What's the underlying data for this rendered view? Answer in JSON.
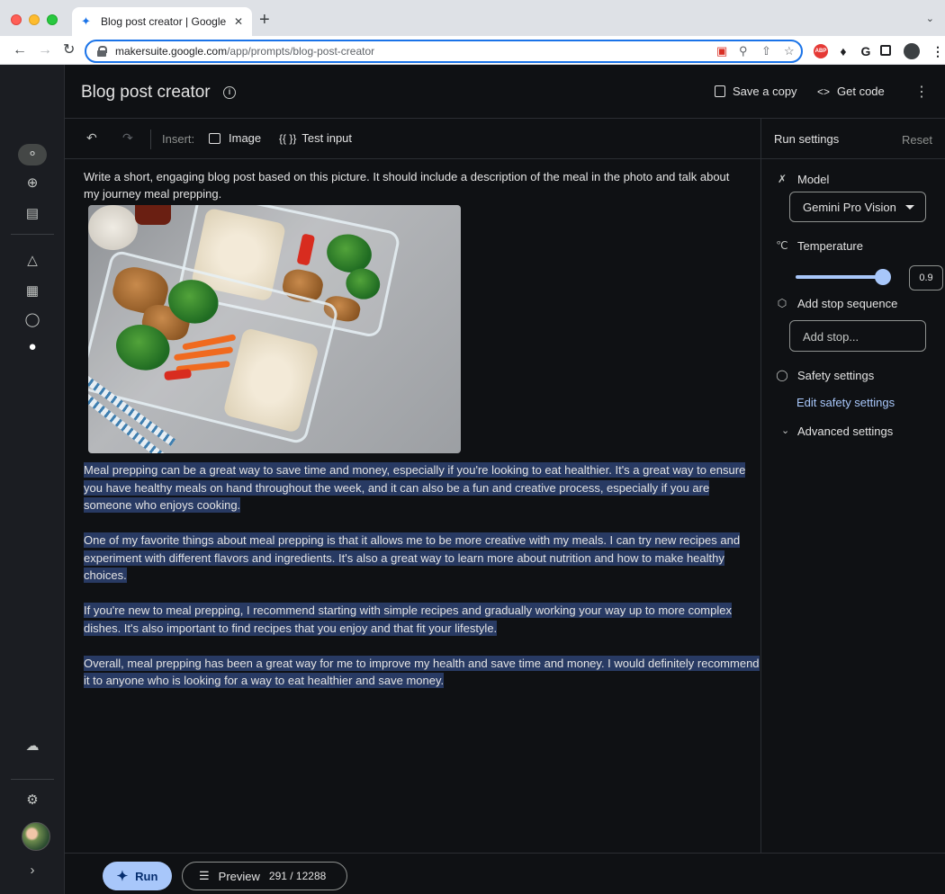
{
  "browser": {
    "tab_title": "Blog post creator | Google AI S",
    "tab_close": "✕",
    "new_tab": "+",
    "tab_menu": "⌄",
    "url_host": "makersuite.google.com",
    "url_path": "/app/prompts/blog-post-creator",
    "icons": [
      "favicon-butterfly-icon",
      "lock-icon",
      "cast-icon",
      "zoom-icon",
      "share-icon",
      "bookmark-star-icon",
      "adblock-icon",
      "extensions-puzzle-icon",
      "google-icon",
      "side-panel-icon",
      "profile-avatar-icon",
      "more-vert-icon"
    ],
    "ext_abp_label": "ABP",
    "ext_g_label": "G"
  },
  "header": {
    "title": "Blog post creator",
    "save_copy_label": "Save a copy",
    "get_code_label": "Get code"
  },
  "editor_toolbar": {
    "insert_label": "Insert:",
    "image_label": "Image",
    "braces": "{{ }}",
    "test_input_label": "Test input"
  },
  "prompt": {
    "text": "Write a short, engaging blog post based on this picture. It should include a description of the meal in the photo and talk about my journey meal prepping."
  },
  "output": {
    "paragraphs": [
      " Meal prepping can be a great way to save time and money, especially if you're looking to eat healthier. It's a great way to ensure you have healthy meals on hand throughout the week, and it can also be a fun and creative process, especially if you are someone who enjoys cooking.",
      "One of my favorite things about meal prepping is that it allows me to be more creative with my meals. I can try new recipes and experiment with different flavors and ingredients. It's also a great way to learn more about nutrition and how to make healthy choices.",
      "If you're new to meal prepping, I recommend starting with simple recipes and gradually working your way up to more complex dishes. It's also important to find recipes that you enjoy and that fit your lifestyle.",
      "Overall, meal prepping has been a great way for me to improve my health and save time and money. I would definitely recommend it to anyone who is looking for a way to eat healthier and save money."
    ]
  },
  "footer": {
    "run_label": "Run",
    "preview_label": "Preview",
    "token_count": "291 / 12288"
  },
  "settings": {
    "title": "Run settings",
    "reset_label": "Reset",
    "model_label": "Model",
    "model_value": "Gemini Pro Vision",
    "temperature_label": "Temperature",
    "temperature_value": "0.9",
    "temperature_fraction": 0.9,
    "stop_sequence_label": "Add stop sequence",
    "stop_placeholder": "Add stop...",
    "safety_label": "Safety settings",
    "edit_safety_label": "Edit safety settings",
    "advanced_label": "Advanced settings"
  },
  "colors": {
    "app_bg": "#0f1114",
    "rail_bg": "#1b1d22",
    "accent": "#a8c7fa",
    "highlight": "#283a63",
    "omnibox_focus": "#1a73e8"
  }
}
